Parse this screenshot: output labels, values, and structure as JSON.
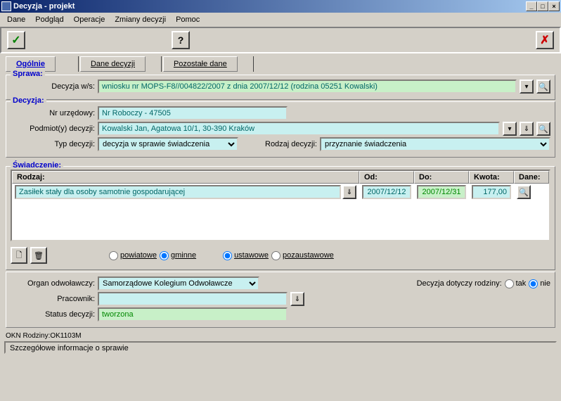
{
  "window": {
    "title": "Decyzja - projekt"
  },
  "menu": {
    "dane": "Dane",
    "podglad": "Podgląd",
    "operacje": "Operacje",
    "zmiany": "Zmiany decyzji",
    "pomoc": "Pomoc"
  },
  "tabs": {
    "ogolnie": "Ogólnie",
    "dane_decyzji": "Dane decyzji",
    "pozostale": "Pozostałe dane"
  },
  "sprawa": {
    "legend": "Sprawa:",
    "decyzja_ws_label": "Decyzja w/s:",
    "decyzja_ws_value": "wniosku nr MOPS-F8//004822/2007 z dnia 2007/12/12 (rodzina 05251 Kowalski)"
  },
  "decyzja": {
    "legend": "Decyzja:",
    "nr_urzedowy_label": "Nr urzędowy:",
    "nr_urzedowy_value": "Nr Roboczy - 47505",
    "podmioty_label": "Podmiot(y) decyzji:",
    "podmioty_value": "Kowalski Jan, Agatowa 10/1, 30-390 Kraków",
    "typ_label": "Typ decyzji:",
    "typ_value": "decyzja w sprawie świadczenia",
    "rodzaj_label": "Rodzaj decyzji:",
    "rodzaj_value": "przyznanie świadczenia"
  },
  "swiadczenie": {
    "legend": "Świadczenie:",
    "col_rodzaj": "Rodzaj:",
    "col_od": "Od:",
    "col_do": "Do:",
    "col_kwota": "Kwota:",
    "col_dane": "Dane:",
    "row_rodzaj": "Zasiłek stały dla osoby samotnie gospodarującej",
    "row_od": "2007/12/12",
    "row_do": "2007/12/31",
    "row_kwota": "177,00"
  },
  "radios": {
    "powiatowe": "powiatowe",
    "gminne": "gminne",
    "ustawowe": "ustawowe",
    "pozaustawowe": "pozaustawowe"
  },
  "footer": {
    "organ_label": "Organ odwoławczy:",
    "organ_value": "Samorządowe Kolegium Odwoławcze",
    "dotyczy_label": "Decyzja dotyczy rodziny:",
    "tak": "tak",
    "nie": "nie",
    "pracownik_label": "Pracownik:",
    "status_label": "Status decyzji:",
    "status_value": "tworzona"
  },
  "status_line": "OKN Rodziny:OK1103M",
  "status_bar": "Szczegółowe informacje o sprawie"
}
